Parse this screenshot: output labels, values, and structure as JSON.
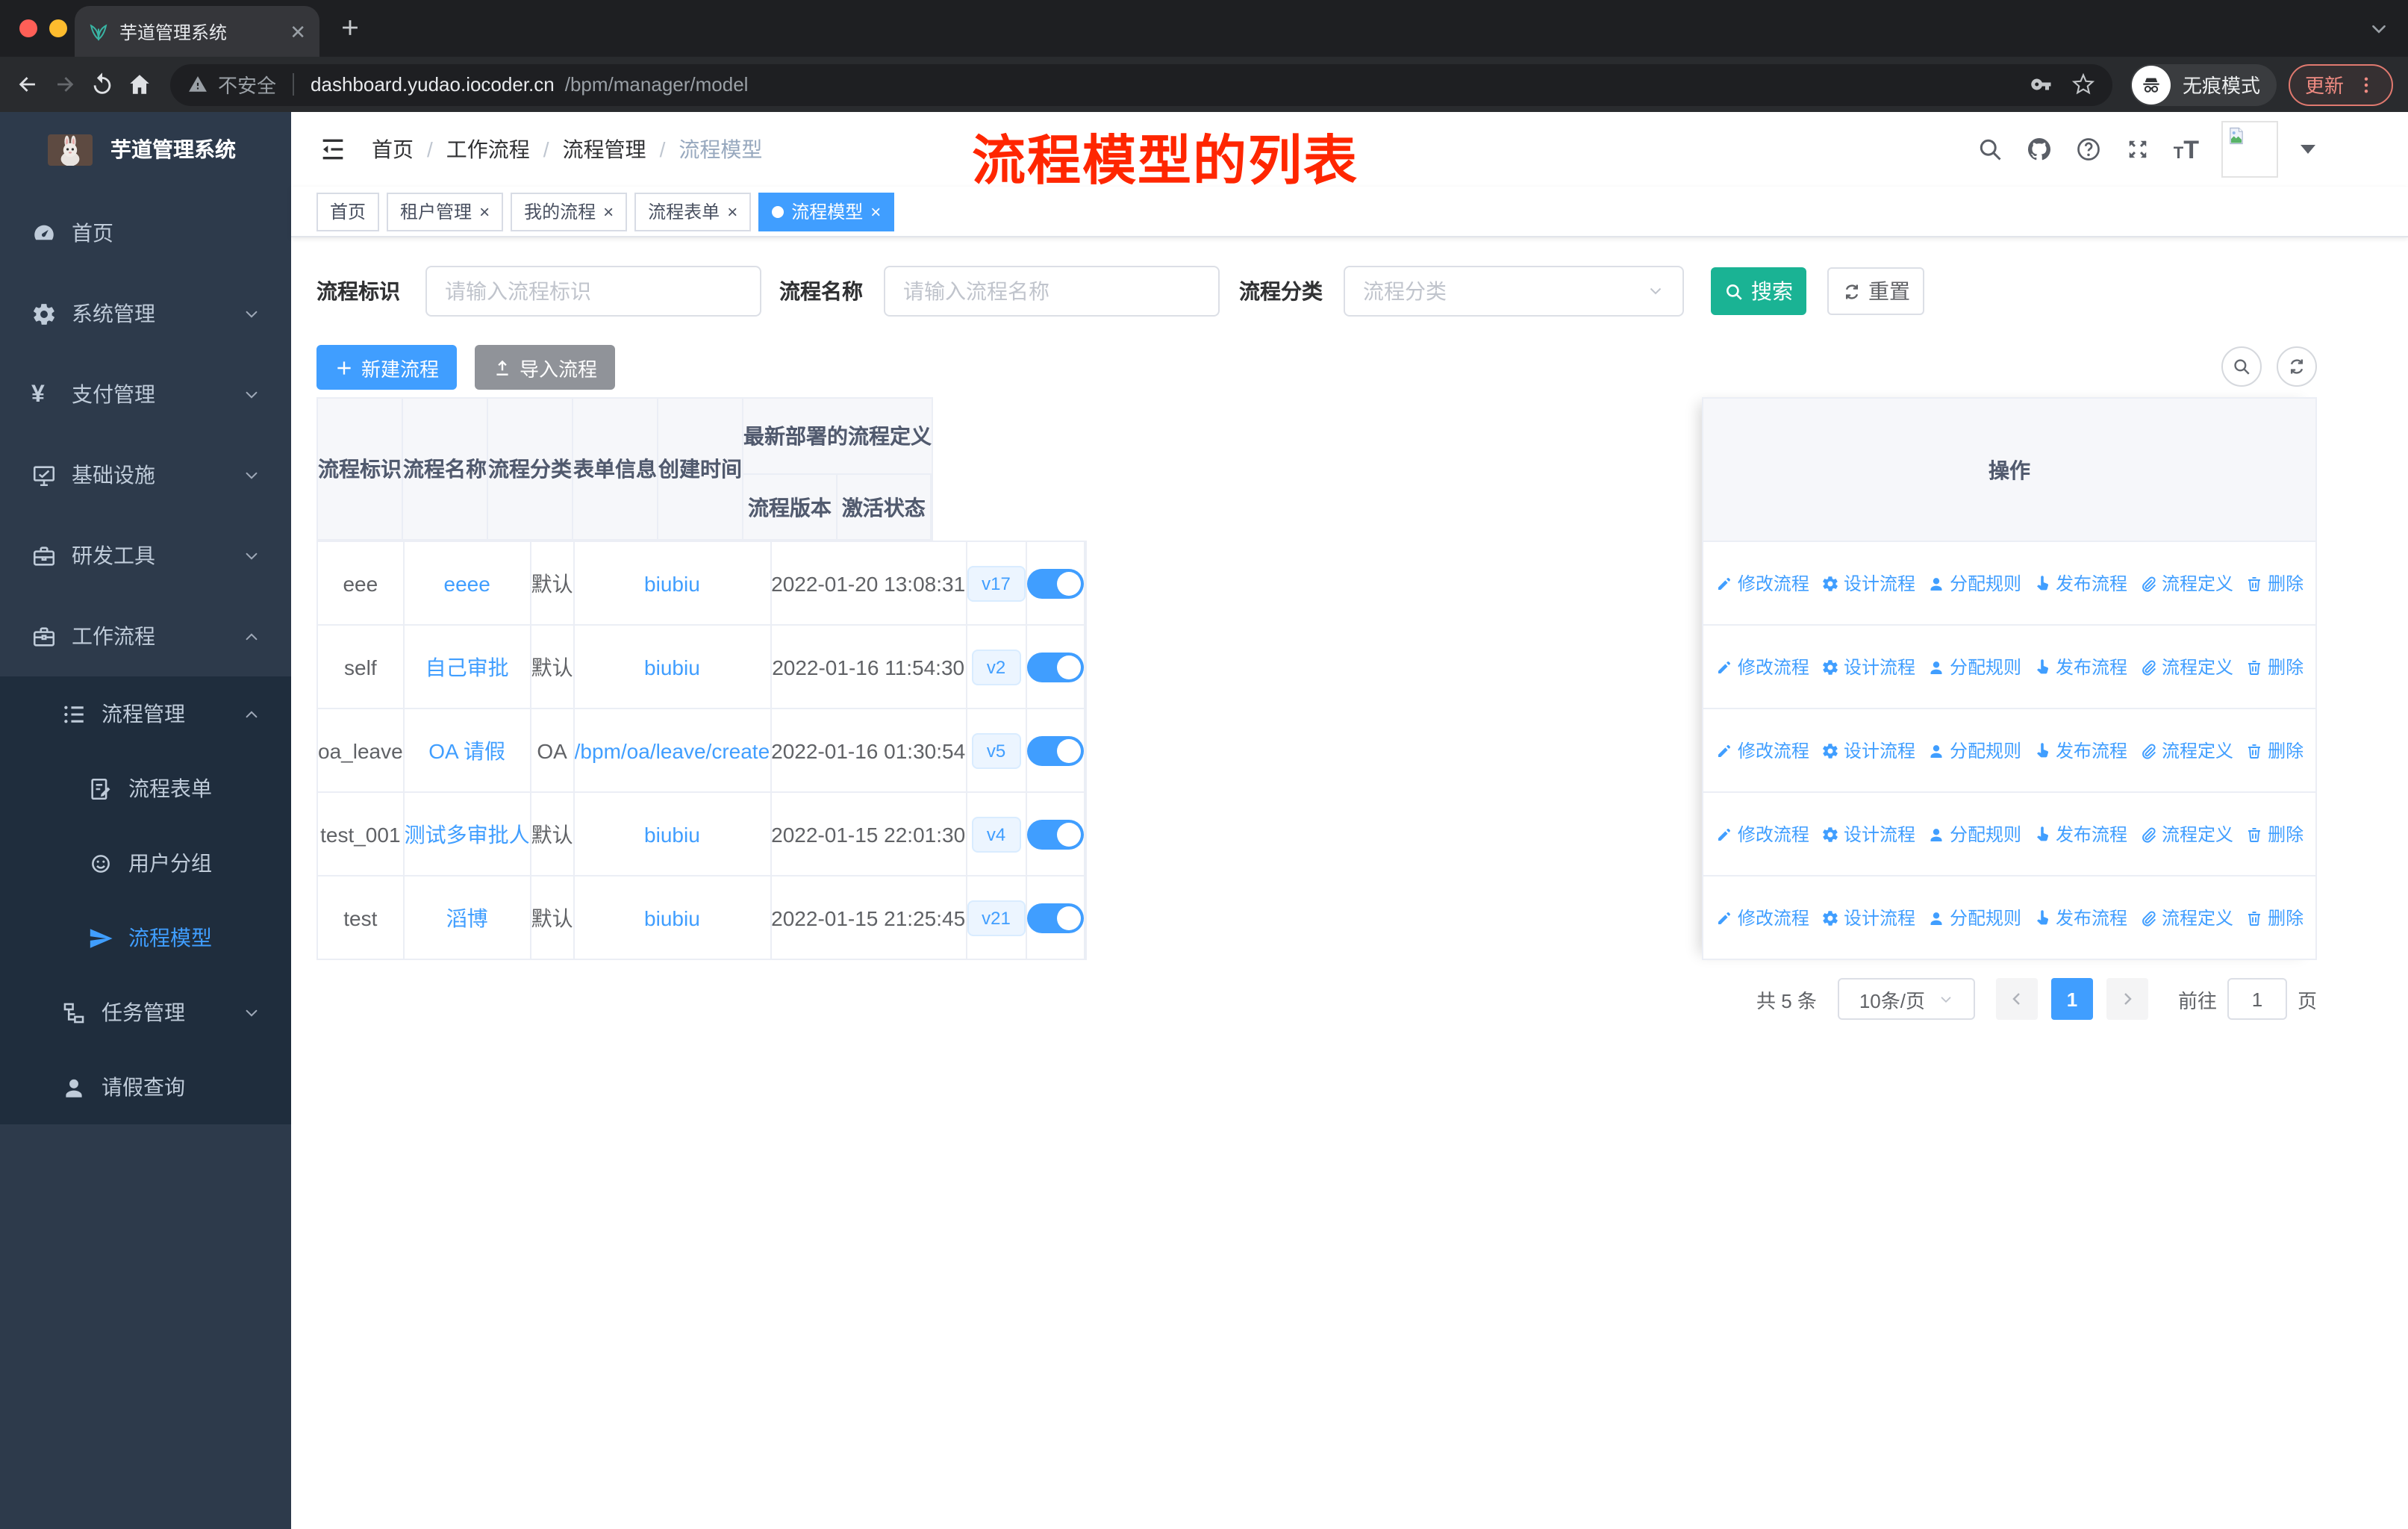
{
  "browser": {
    "tab_title": "芋道管理系统",
    "security_label": "不安全",
    "url_host": "dashboard.yudao.iocoder.cn",
    "url_path": "/bpm/manager/model",
    "incognito_label": "无痕模式",
    "update_label": "更新"
  },
  "sidebar": {
    "title": "芋道管理系统",
    "items": [
      {
        "id": "home",
        "label": "首页",
        "icon": "dashboard-icon",
        "level": 1
      },
      {
        "id": "system",
        "label": "系统管理",
        "icon": "gear-icon",
        "level": 1,
        "arrow": "down"
      },
      {
        "id": "payment",
        "label": "支付管理",
        "icon": "yen-icon",
        "level": 1,
        "arrow": "down"
      },
      {
        "id": "infra",
        "label": "基础设施",
        "icon": "monitor-icon",
        "level": 1,
        "arrow": "down"
      },
      {
        "id": "devtools",
        "label": "研发工具",
        "icon": "toolbox-icon",
        "level": 1,
        "arrow": "down"
      },
      {
        "id": "workflow",
        "label": "工作流程",
        "icon": "briefcase-icon",
        "level": 1,
        "arrow": "up"
      },
      {
        "id": "process-manage",
        "label": "流程管理",
        "icon": "flow-list-icon",
        "level": 2,
        "arrow": "up"
      },
      {
        "id": "process-form",
        "label": "流程表单",
        "icon": "form-icon",
        "level": 3
      },
      {
        "id": "user-group",
        "label": "用户分组",
        "icon": "user-group-icon",
        "level": 3
      },
      {
        "id": "process-model",
        "label": "流程模型",
        "icon": "paper-plane-icon",
        "level": 3,
        "active": true
      },
      {
        "id": "task-manage",
        "label": "任务管理",
        "icon": "task-tree-icon",
        "level": 2,
        "arrow": "down"
      },
      {
        "id": "leave-query",
        "label": "请假查询",
        "icon": "user-icon",
        "level": 2
      }
    ]
  },
  "navbar": {
    "breadcrumb": [
      "首页",
      "工作流程",
      "流程管理",
      "流程模型"
    ],
    "annotation": "流程模型的列表",
    "icons": [
      "search-icon",
      "github-icon",
      "help-icon",
      "fullscreen-icon",
      "font-size-icon"
    ]
  },
  "tags": [
    {
      "label": "首页",
      "closable": false,
      "active": false
    },
    {
      "label": "租户管理",
      "closable": true,
      "active": false
    },
    {
      "label": "我的流程",
      "closable": true,
      "active": false
    },
    {
      "label": "流程表单",
      "closable": true,
      "active": false
    },
    {
      "label": "流程模型",
      "closable": true,
      "active": true
    }
  ],
  "filters": {
    "key_label": "流程标识",
    "key_placeholder": "请输入流程标识",
    "name_label": "流程名称",
    "name_placeholder": "请输入流程名称",
    "category_label": "流程分类",
    "category_placeholder": "流程分类",
    "search_label": "搜索",
    "reset_label": "重置"
  },
  "toolbar": {
    "create_label": "新建流程",
    "import_label": "导入流程"
  },
  "table": {
    "columns": [
      "流程标识",
      "流程名称",
      "流程分类",
      "表单信息",
      "创建时间"
    ],
    "group_header": "最新部署的流程定义",
    "sub_columns": [
      "流程版本",
      "激活状态"
    ],
    "op_header": "操作",
    "actions": [
      {
        "label": "修改流程",
        "icon": "edit-icon"
      },
      {
        "label": "设计流程",
        "icon": "design-icon"
      },
      {
        "label": "分配规则",
        "icon": "assign-icon"
      },
      {
        "label": "发布流程",
        "icon": "publish-icon"
      },
      {
        "label": "流程定义",
        "icon": "definition-icon"
      },
      {
        "label": "删除",
        "icon": "delete-icon"
      }
    ],
    "rows": [
      {
        "key": "eee",
        "name": "eeee",
        "category": "默认",
        "form": "biubiu",
        "created": "2022-01-20 13:08:31",
        "version": "v17",
        "active": true
      },
      {
        "key": "self",
        "name": "自己审批",
        "category": "默认",
        "form": "biubiu",
        "created": "2022-01-16 11:54:30",
        "version": "v2",
        "active": true
      },
      {
        "key": "oa_leave",
        "name": "OA 请假",
        "category": "OA",
        "form": "/bpm/oa/leave/create",
        "created": "2022-01-16 01:30:54",
        "version": "v5",
        "active": true
      },
      {
        "key": "test_001",
        "name": "测试多审批人",
        "category": "默认",
        "form": "biubiu",
        "created": "2022-01-15 22:01:30",
        "version": "v4",
        "active": true
      },
      {
        "key": "test",
        "name": "滔博",
        "category": "默认",
        "form": "biubiu",
        "created": "2022-01-15 21:25:45",
        "version": "v21",
        "active": true
      }
    ]
  },
  "pagination": {
    "total": "共 5 条",
    "page_size": "10条/页",
    "current": "1",
    "goto_label": "前往",
    "goto_value": "1",
    "unit_label": "页"
  },
  "colors": {
    "primary": "#409EFF",
    "search_button": "#1AB394",
    "sidebar_bg": "#2d3a4b",
    "submenu_bg": "#1f2d3d",
    "annotation_red": "#ff2600"
  }
}
